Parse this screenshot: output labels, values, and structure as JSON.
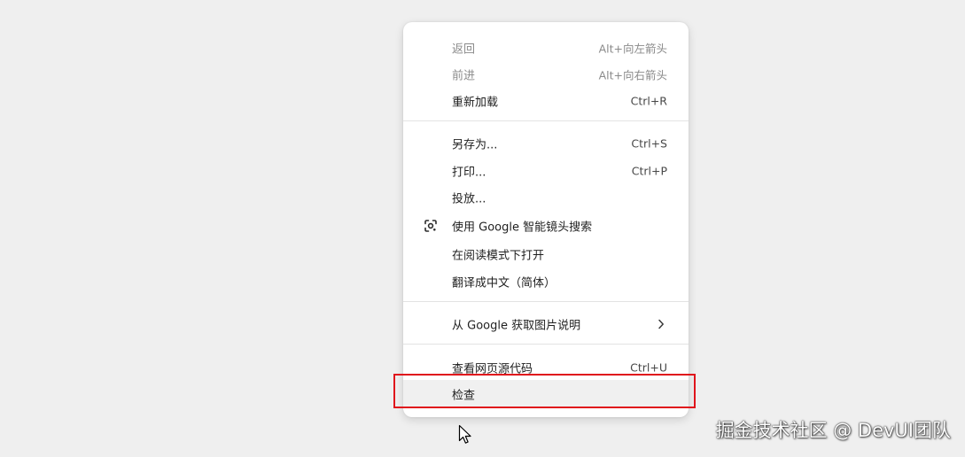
{
  "context_menu": {
    "group1": {
      "back": {
        "label": "返回",
        "shortcut": "Alt+向左箭头"
      },
      "forward": {
        "label": "前进",
        "shortcut": "Alt+向右箭头"
      },
      "reload": {
        "label": "重新加载",
        "shortcut": "Ctrl+R"
      }
    },
    "group2": {
      "save_as": {
        "label": "另存为...",
        "shortcut": "Ctrl+S"
      },
      "print": {
        "label": "打印...",
        "shortcut": "Ctrl+P"
      },
      "cast": {
        "label": "投放..."
      },
      "google_lens": {
        "label": "使用 Google 智能镜头搜索",
        "icon": "google-lens-icon"
      },
      "reading_mode": {
        "label": "在阅读模式下打开"
      },
      "translate": {
        "label": "翻译成中文（简体）"
      }
    },
    "group3": {
      "image_descriptions": {
        "label": "从 Google 获取图片说明",
        "icon": "chevron-right-icon"
      }
    },
    "group4": {
      "view_source": {
        "label": "查看网页源代码",
        "shortcut": "Ctrl+U"
      },
      "inspect": {
        "label": "检查"
      }
    }
  },
  "watermark": {
    "text": "掘金技术社区 @ DevUI团队"
  },
  "colors": {
    "background": "#efefef",
    "menu_background": "#ffffff",
    "highlight_border": "#e0141c",
    "hover_background": "#f0f0f0"
  }
}
